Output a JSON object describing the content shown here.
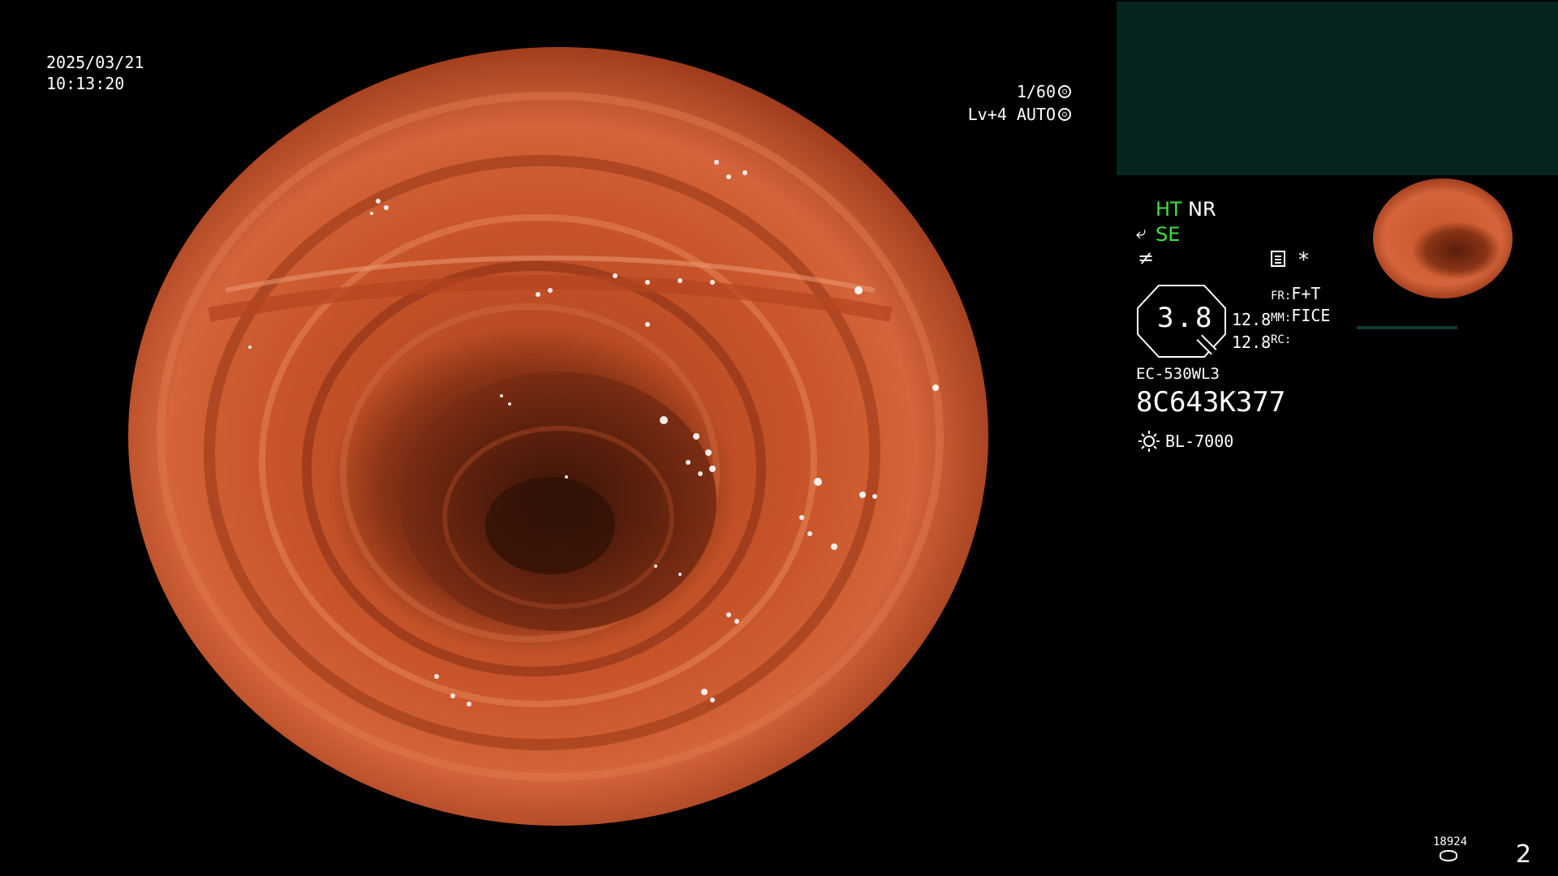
{
  "datetime": {
    "date": "2025/03/21",
    "time": "10:13:20"
  },
  "shutter": {
    "speed": "1/60",
    "level": "Lv+4 AUTO",
    "speed_icon": "shutter-icon",
    "auto_icon": "iris-icon"
  },
  "modes": {
    "ht": "HT",
    "nr": "NR",
    "se": "SE",
    "structure_icon": "structure-enhance-icon",
    "color_icon": "color-enhance-icon",
    "doc_icon": "document-icon",
    "asterisk": "*"
  },
  "zoom": {
    "value": "3.8",
    "mm_top": "12.8",
    "mm_bottom": "12.8"
  },
  "settings": {
    "fr_label": "FR:",
    "fr_value": "F+T",
    "mm_label": "MM:",
    "mm_value": "FICE",
    "rc_label": "RC:",
    "rc_value": ""
  },
  "device": {
    "model": "EC-530WL3",
    "serial": "8C643K377",
    "light_source": "BL-7000",
    "light_icon": "light-source-icon"
  },
  "footer": {
    "counter": "18924",
    "page": "2",
    "storage_icon": "storage-icon"
  },
  "colors": {
    "green": "#3fe03f",
    "teal_panel": "#062420",
    "tissue": "#c9552a"
  }
}
